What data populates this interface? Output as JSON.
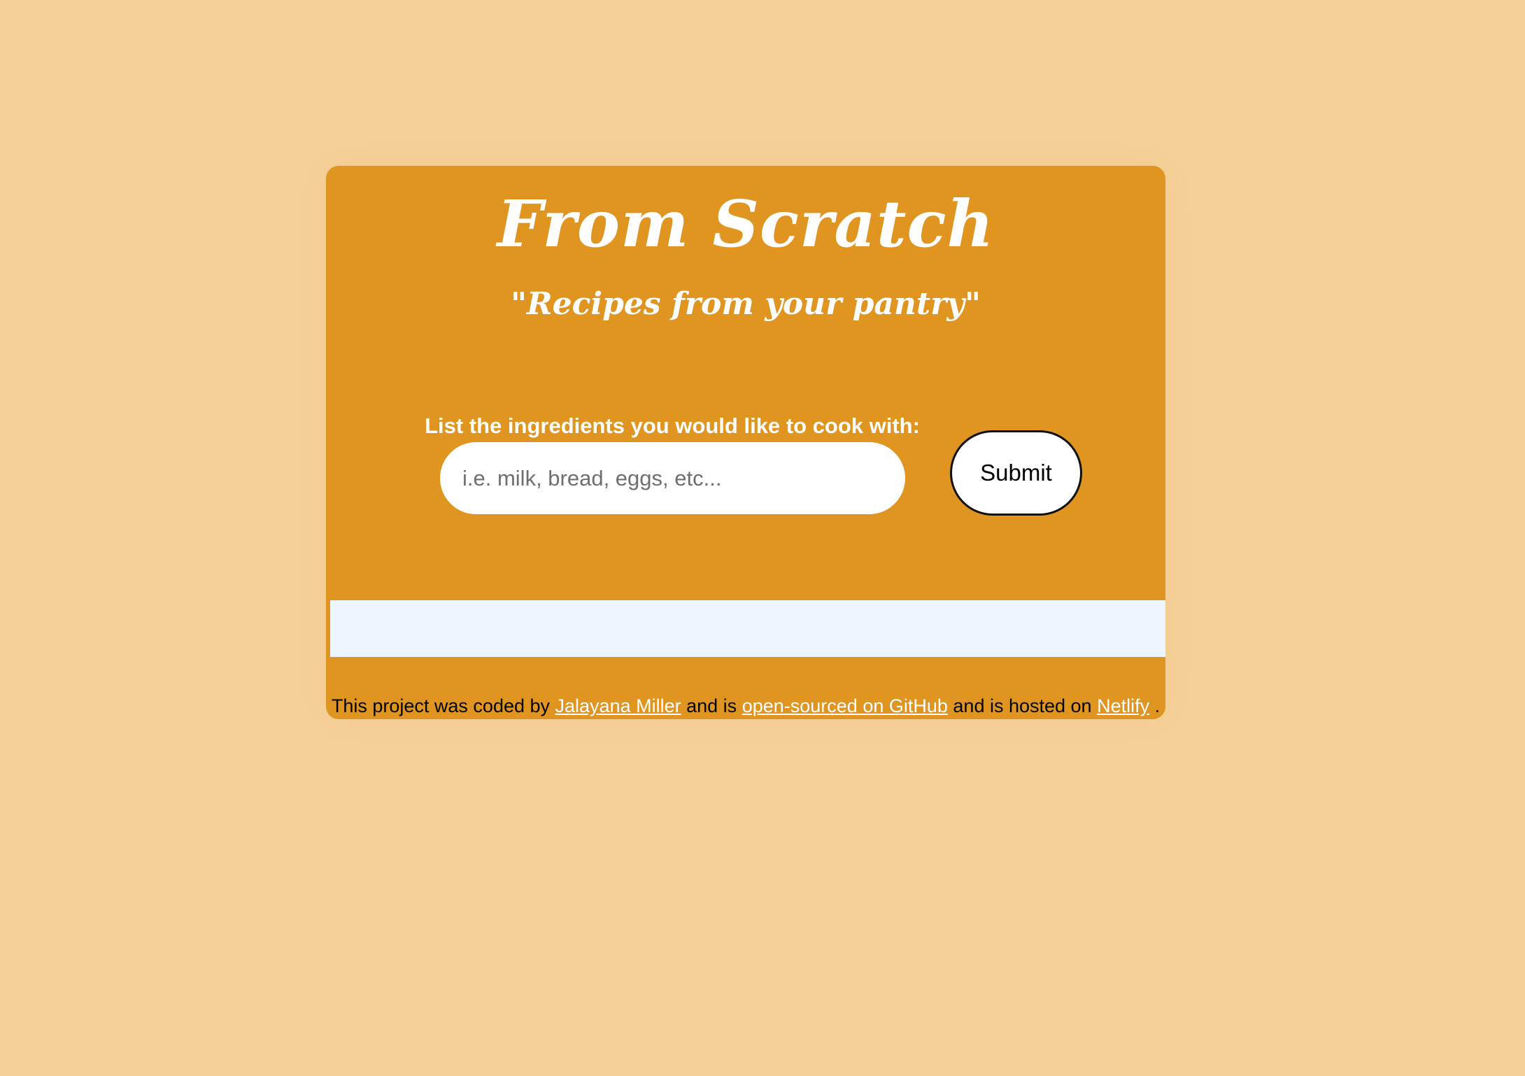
{
  "header": {
    "title": "From Scratch",
    "subtitle": "\"Recipes from your pantry\""
  },
  "search": {
    "label": "List the ingredients you would like to cook with:",
    "placeholder": "i.e. milk, bread, eggs, etc...",
    "value": "",
    "submit_label": "Submit"
  },
  "footer": {
    "text_1": "This project was coded by",
    "author_link": "Jalayana Miller",
    "text_2": "and is",
    "github_link": "open-sourced on GitHub",
    "text_3": "and is hosted on",
    "netlify_link": "Netlify",
    "text_4": "."
  },
  "colors": {
    "page_background": "#f6d29b",
    "card_background": "#df9520",
    "results_background": "#edf5ff",
    "link": "#ffffff"
  }
}
